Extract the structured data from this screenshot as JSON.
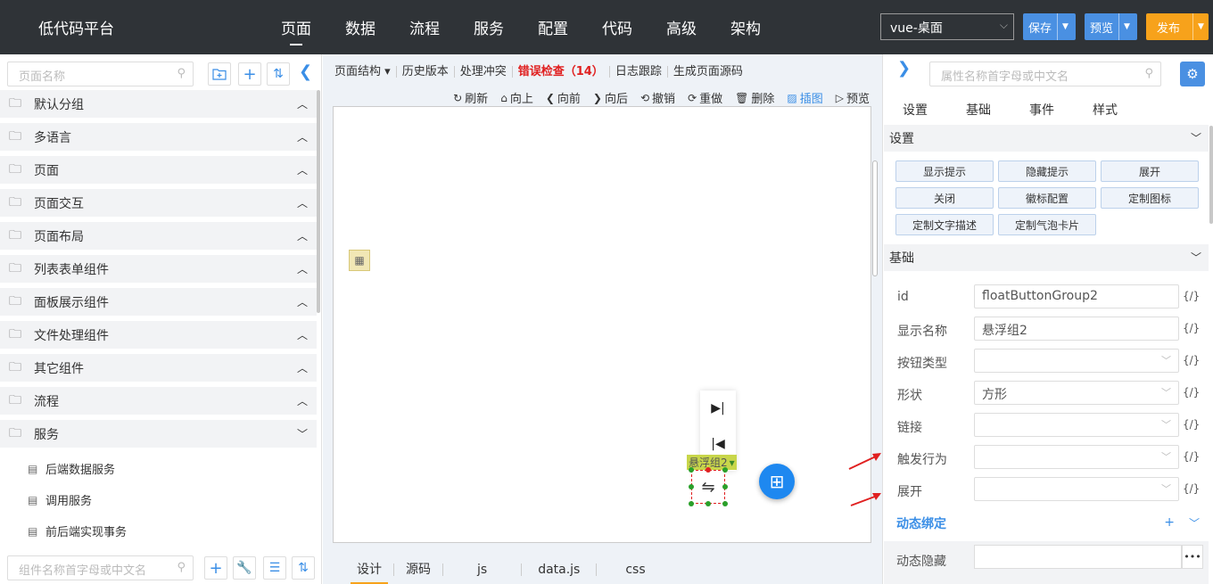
{
  "header": {
    "brand": "低代码平台",
    "nav": [
      "页面",
      "数据",
      "流程",
      "服务",
      "配置",
      "代码",
      "高级",
      "架构"
    ],
    "env_selected": "vue-桌面",
    "save_label": "保存",
    "preview_label": "预览",
    "publish_label": "发布",
    "colors": {
      "bg": "#2f3337",
      "primary": "#4a90e2",
      "publish": "#f7a21b"
    }
  },
  "sidebar": {
    "search_placeholder": "页面名称",
    "groups": [
      "默认分组",
      "多语言",
      "页面",
      "页面交互",
      "页面布局",
      "列表表单组件",
      "面板展示组件",
      "文件处理组件",
      "其它组件",
      "流程",
      "服务"
    ],
    "service_items": [
      "后端数据服务",
      "调用服务",
      "前后端实现事务"
    ],
    "component_search_placeholder": "组件名称首字母或中文名"
  },
  "center": {
    "toolbar": {
      "page_structure": "页面结构",
      "history": "历史版本",
      "conflict": "处理冲突",
      "error_check": "错误检查（14）",
      "log": "日志跟踪",
      "gen_source": "生成页面源码"
    },
    "actions": [
      "刷新",
      "向上",
      "向前",
      "向后",
      "撤销",
      "重做",
      "删除",
      "插图",
      "预览"
    ],
    "float_tag": "悬浮组2",
    "tabs": [
      "设计",
      "源码",
      "js",
      "data.js",
      "css"
    ]
  },
  "right": {
    "search_placeholder": "属性名称首字母或中文名",
    "tabs": [
      "设置",
      "基础",
      "事件",
      "样式"
    ],
    "section_settings": "设置",
    "setting_buttons": [
      "显示提示",
      "隐藏提示",
      "展开",
      "关闭",
      "徽标配置",
      "定制图标",
      "定制文字描述",
      "定制气泡卡片"
    ],
    "section_basic": "基础",
    "fields": [
      {
        "label": "id",
        "value": "floatButtonGroup2"
      },
      {
        "label": "显示名称",
        "value": "悬浮组2"
      },
      {
        "label": "按钮类型",
        "value": ""
      },
      {
        "label": "形状",
        "value": "方形"
      },
      {
        "label": "链接",
        "value": ""
      },
      {
        "label": "触发行为",
        "value": ""
      },
      {
        "label": "展开",
        "value": ""
      }
    ],
    "fx_label": "{/}",
    "dynamic_binding": "动态绑定",
    "dynamic_hide": "动态隐藏"
  }
}
